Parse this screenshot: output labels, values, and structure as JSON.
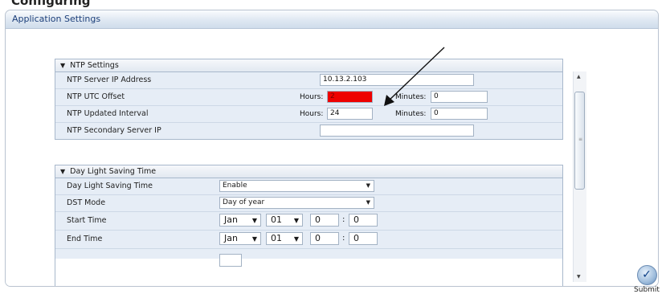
{
  "page_heading": "Configuring",
  "window": {
    "title": "Application Settings"
  },
  "ntp": {
    "header": "NTP Settings",
    "rows": {
      "server_ip": {
        "label": "NTP Server IP Address",
        "value": "10.13.2.103"
      },
      "utc_offset": {
        "label": "NTP UTC Offset",
        "hours_label": "Hours:",
        "hours_value": "2",
        "minutes_label": "Minutes:",
        "minutes_value": "0"
      },
      "update_interval": {
        "label": "NTP Updated Interval",
        "hours_label": "Hours:",
        "hours_value": "24",
        "minutes_label": "Minutes:",
        "minutes_value": "0"
      },
      "secondary_ip": {
        "label": "NTP Secondary Server IP",
        "value": ""
      }
    }
  },
  "dst": {
    "header": "Day Light Saving Time",
    "rows": {
      "mode_enable": {
        "label": "Day Light Saving Time",
        "value": "Enable"
      },
      "dst_mode": {
        "label": "DST Mode",
        "value": "Day of year"
      },
      "start_time": {
        "label": "Start Time",
        "month": "Jan",
        "day": "01",
        "hour": "0",
        "colon": ":",
        "minute": "0"
      },
      "end_time": {
        "label": "End Time",
        "month": "Jan",
        "day": "01",
        "hour": "0",
        "colon": ":",
        "minute": "0"
      }
    }
  },
  "submit": {
    "label": "Submit",
    "icon": "checkmark-icon"
  },
  "colors": {
    "highlight": "#ee0000",
    "row_bg": "#e6edf6",
    "title_text": "#1c3f7a"
  }
}
